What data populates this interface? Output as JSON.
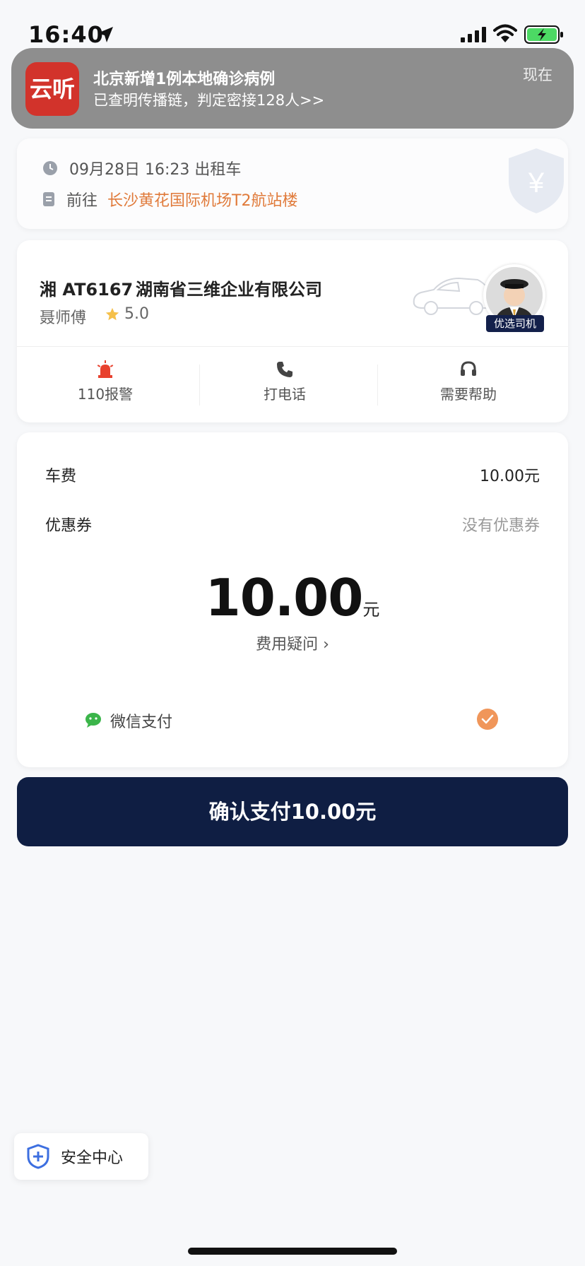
{
  "status_bar": {
    "time": "16:40"
  },
  "notification": {
    "app_icon_text": "云听",
    "title": "北京新增1例本地确诊病例",
    "body": "已查明传播链，判定密接128人>>",
    "time": "现在"
  },
  "trip": {
    "datetime": "09月28日 16:23 出租车",
    "destination_prefix": "前往",
    "destination": "长沙黄花国际机场T2航站楼",
    "shield_symbol": "¥"
  },
  "driver": {
    "plate": "湘 AT6167",
    "company": "湖南省三维企业有限公司",
    "name": "聂师傅",
    "rating": "5.0",
    "badge": "优选司机"
  },
  "actions": [
    {
      "label": "110报警",
      "icon": "alarm-icon"
    },
    {
      "label": "打电话",
      "icon": "phone-icon"
    },
    {
      "label": "需要帮助",
      "icon": "headset-icon"
    }
  ],
  "payment": {
    "fee_label": "车费",
    "fee_value": "10.00元",
    "coupon_label": "优惠券",
    "coupon_value": "没有优惠券",
    "amount": "10.00",
    "amount_unit": "元",
    "fee_question": "费用疑问 ›",
    "method": "微信支付"
  },
  "confirm_button": "确认支付10.00元",
  "safety_center": "安全中心",
  "colors": {
    "accent_orange": "#e07a3a",
    "button_navy": "#0f1e43",
    "wechat_green": "#3bb54a",
    "alarm_red": "#e8412e"
  }
}
